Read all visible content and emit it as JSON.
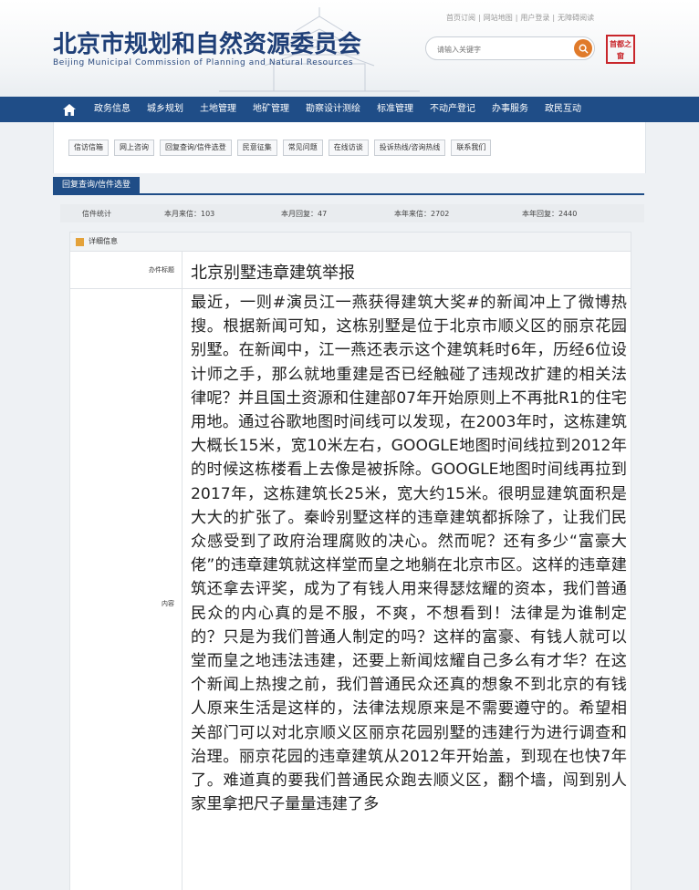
{
  "site": {
    "title_cn": "北京市规划和自然资源委员会",
    "title_en": "Beijing  Municipal  Commission  of  Planning  and  Natural  Resources"
  },
  "top_links": [
    "首页订阅",
    "网站地图",
    "用户登录",
    "无障碍阅读"
  ],
  "search": {
    "placeholder": "请输入关键字"
  },
  "seal": {
    "text": "首都之窗"
  },
  "nav": {
    "items": [
      "政务信息",
      "城乡规划",
      "土地管理",
      "地矿管理",
      "勘察设计测绘",
      "标准管理",
      "不动产登记",
      "办事服务",
      "政民互动"
    ]
  },
  "submenu": {
    "items": [
      "信访信箱",
      "网上咨询",
      "回复查询/信件选登",
      "民意征集",
      "常见问题",
      "在线访谈",
      "投诉热线/咨询热线",
      "联系我们"
    ]
  },
  "section": {
    "title": "回复查询/信件选登"
  },
  "stats": {
    "label": "信件统计",
    "month_received": "本月来信：103",
    "month_replied": "本月回复：47",
    "year_received": "本年来信：2702",
    "year_replied": "本年回复：2440"
  },
  "detail": {
    "header": "详细信息",
    "subject_label": "办件标题",
    "subject": "北京别墅违章建筑举报",
    "content_label": "内容",
    "content": "最近，一则#演员江一燕获得建筑大奖#的新闻冲上了微博热搜。根据新闻可知，这栋别墅是位于北京市顺义区的丽京花园别墅。在新闻中，江一燕还表示这个建筑耗时6年，历经6位设计师之手，那么就地重建是否已经触碰了违规改扩建的相关法律呢？并且国土资源和住建部07年开始原则上不再批R1的住宅用地。通过谷歌地图时间线可以发现，在2003年时，这栋建筑大概长15米，宽10米左右，GOOGLE地图时间线拉到2012年的时候这栋楼看上去像是被拆除。GOOGLE地图时间线再拉到2017年，这栋建筑长25米，宽大约15米。很明显建筑面积是大大的扩张了。秦岭别墅这样的违章建筑都拆除了，让我们民众感受到了政府治理腐败的决心。然而呢？还有多少“富豪大佬”的违章建筑就这样堂而皇之地躺在北京市区。这样的违章建筑还拿去评奖，成为了有钱人用来得瑟炫耀的资本，我们普通民众的内心真的是不服，不爽，不想看到！法律是为谁制定的？只是为我们普通人制定的吗？这样的富豪、有钱人就可以堂而皇之地违法违建，还要上新闻炫耀自己多么有才华？在这个新闻上热搜之前，我们普通民众还真的想象不到北京的有钱人原来生活是这样的，法律法规原来是不需要遵守的。希望相关部门可以对北京顺义区丽京花园别墅的违建行为进行调查和治理。丽京花园的违章建筑从2012年开始盖，到现在也快7年了。难道真的要我们普通民众跑去顺义区，翻个墙，闯到别人家里拿把尺子量量违建了多"
  },
  "colors": {
    "nav_bg": "#1f4d87",
    "brand": "#1f3f77",
    "search_btn": "#e07a2a",
    "seal": "#c8262b"
  }
}
